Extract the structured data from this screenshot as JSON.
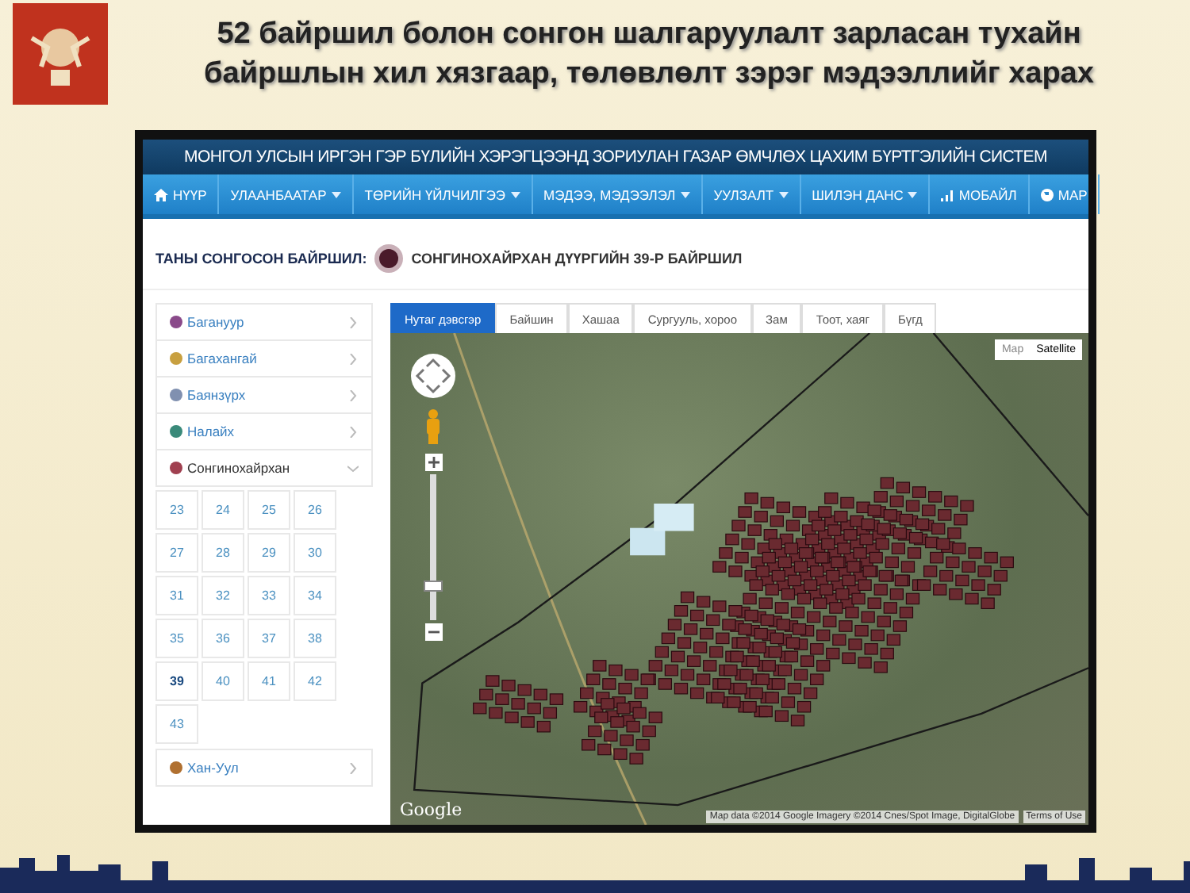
{
  "slide": {
    "title_lines": [
      "52 байршил болон сонгон шалгаруулалт зарласан тухайн",
      "байршлын хил хязгаар, төлөвлөлт зэрэг мэдээллийг харах"
    ]
  },
  "site": {
    "title": "МОНГОЛ УЛСЫН ИРГЭН ГЭР БҮЛИЙН ХЭРЭГЦЭЭНД ЗОРИУЛАН ГАЗАР ӨМЧЛӨХ ЦАХИМ БҮРТГЭЛИЙН СИСТЕМ",
    "nav": [
      {
        "label": "НҮҮР",
        "kind": "home",
        "dropdown": false
      },
      {
        "label": "УЛААНБААТАР",
        "kind": "plain",
        "dropdown": true
      },
      {
        "label": "ТӨРИЙН ҮЙЛЧИЛГЭЭ",
        "kind": "plain",
        "dropdown": true
      },
      {
        "label": "МЭДЭЭ, МЭДЭЭЛЭЛ",
        "kind": "plain",
        "dropdown": true
      },
      {
        "label": "УУЛЗАЛТ",
        "kind": "plain",
        "dropdown": true
      },
      {
        "label": "ШИЛЭН ДАНС",
        "kind": "plain",
        "dropdown": true
      },
      {
        "label": "МОБАЙЛ",
        "kind": "mobile",
        "dropdown": false
      },
      {
        "label": "МАР",
        "kind": "map",
        "dropdown": false
      }
    ]
  },
  "location": {
    "label": "ТАНЫ СОНГОСОН БАЙРШИЛ:",
    "value": "СОНГИНОХАЙРХАН ДҮҮРГИЙН 39-Р БАЙРШИЛ"
  },
  "sidebar": {
    "items": [
      {
        "label": "Багануур",
        "expanded": false,
        "color": "#8a4a8a"
      },
      {
        "label": "Багахангай",
        "expanded": false,
        "color": "#c8a040"
      },
      {
        "label": "Баянзүрх",
        "expanded": false,
        "color": "#8090b0"
      },
      {
        "label": "Налайх",
        "expanded": false,
        "color": "#3a8a7a"
      },
      {
        "label": "Сонгинохайрхан",
        "expanded": true,
        "color": "#a04050",
        "children": [
          {
            "label": "23",
            "selected": false
          },
          {
            "label": "24",
            "selected": false
          },
          {
            "label": "25",
            "selected": false
          },
          {
            "label": "26",
            "selected": false
          },
          {
            "label": "27",
            "selected": false
          },
          {
            "label": "28",
            "selected": false
          },
          {
            "label": "29",
            "selected": false
          },
          {
            "label": "30",
            "selected": false
          },
          {
            "label": "31",
            "selected": false
          },
          {
            "label": "32",
            "selected": false
          },
          {
            "label": "33",
            "selected": false
          },
          {
            "label": "34",
            "selected": false
          },
          {
            "label": "35",
            "selected": false
          },
          {
            "label": "36",
            "selected": false
          },
          {
            "label": "37",
            "selected": false
          },
          {
            "label": "38",
            "selected": false
          },
          {
            "label": "39",
            "selected": true
          },
          {
            "label": "40",
            "selected": false
          },
          {
            "label": "41",
            "selected": false
          },
          {
            "label": "42",
            "selected": false
          },
          {
            "label": "43",
            "selected": false
          }
        ]
      },
      {
        "label": "Хан-Уул",
        "expanded": false,
        "color": "#b07030"
      }
    ]
  },
  "map": {
    "tabs": [
      {
        "label": "Нутаг дэвсгэр",
        "selected": true
      },
      {
        "label": "Байшин",
        "selected": false
      },
      {
        "label": "Хашаа",
        "selected": false
      },
      {
        "label": "Сургууль, хороо",
        "selected": false
      },
      {
        "label": "Зам",
        "selected": false
      },
      {
        "label": "Тоот, хаяг",
        "selected": false
      },
      {
        "label": "Бүгд",
        "selected": false
      }
    ],
    "types": [
      {
        "label": "Map",
        "selected": false
      },
      {
        "label": "Satellite",
        "selected": true
      }
    ],
    "zoom": {
      "level": 0.2
    },
    "brand": "Google",
    "attribution": "Map data ©2014 Google Imagery ©2014 Cnes/Spot Image, DigitalGlobe",
    "terms": "Terms of Use"
  }
}
